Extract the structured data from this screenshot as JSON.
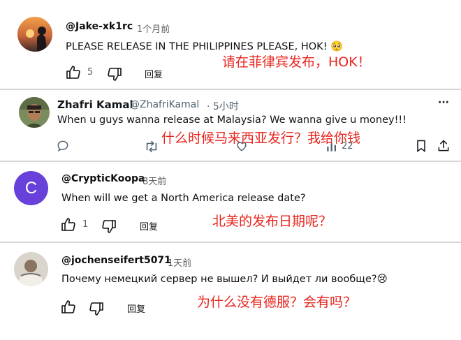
{
  "comments": [
    {
      "handle": "@Jake-xk1rc",
      "time": "1个月前",
      "text": "PLEASE RELEASE IN THE PHILIPPINES PLEASE, HOK!",
      "emoji": "🥺",
      "likes": "5",
      "reply_label": "回复",
      "annotation": "请在菲律宾发布，HOK！"
    },
    {
      "name": "Zhafri Kamal",
      "handle": "@ZhafriKamal",
      "time": "· 5小时",
      "text": "When u guys wanna release at Malaysia? We wanna give u money!!!",
      "views": "22",
      "more": "···",
      "annotation": "什么时候马来西亚发行？我给你钱"
    },
    {
      "handle": "@CrypticKoopa",
      "time": "8天前",
      "avatar_letter": "C",
      "avatar_color": "#6741d9",
      "text": "When will we get a North America release date?",
      "likes": "1",
      "reply_label": "回复",
      "annotation": "北美的发布日期呢？"
    },
    {
      "handle": "@jochenseifert5071",
      "time": "1天前",
      "text": "Почему немецкий сервер не вышел? И выйдет ли вообще?",
      "emoji": "😢",
      "reply_label": "回复",
      "annotation": "为什么没有德服？会有吗？"
    }
  ]
}
